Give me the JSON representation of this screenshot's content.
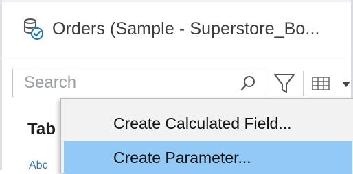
{
  "datasource": {
    "title": "Orders (Sample - Superstore_Bo...",
    "icon": "datasource-icon"
  },
  "search": {
    "placeholder": "Search",
    "value": "",
    "icon": "search-icon"
  },
  "toolbar": {
    "filter_icon": "filter-icon",
    "view_icon": "view-options-icon",
    "dropdown_icon": "dropdown-arrow-icon"
  },
  "pane": {
    "tables_heading": "Tab",
    "field_type_label": "Abc"
  },
  "context_menu": {
    "items": [
      {
        "label": "Create Calculated Field...",
        "highlighted": false
      },
      {
        "label": "Create Parameter...",
        "highlighted": true
      }
    ]
  },
  "colors": {
    "highlight": "#91c9f7",
    "menu_background": "#f2f2f2",
    "accent_blue": "#1f77c9",
    "field_type_blue": "#2f6fb3"
  }
}
